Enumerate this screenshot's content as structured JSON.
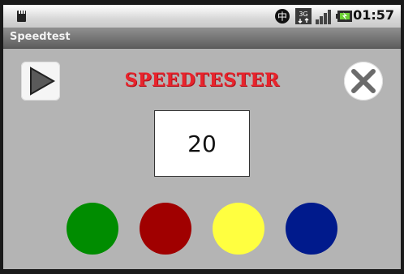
{
  "status_bar": {
    "time": "01:57",
    "network_label": "3G",
    "icons": [
      "sd-card-icon",
      "chinese-input-icon",
      "3g-icon",
      "signal-icon",
      "battery-charging-icon"
    ]
  },
  "title_bar": {
    "title": "Speedtest"
  },
  "main": {
    "heading": "SPEEDTESTER",
    "counter": "20",
    "play_icon": "play-icon",
    "close_icon": "close-icon",
    "color_buttons": [
      {
        "name": "green",
        "color": "#008c00"
      },
      {
        "name": "red",
        "color": "#a00000"
      },
      {
        "name": "yellow",
        "color": "#ffff40"
      },
      {
        "name": "blue",
        "color": "#001a8c"
      }
    ]
  },
  "colors": {
    "heading": "#e8242c",
    "background": "#b4b4b4"
  }
}
